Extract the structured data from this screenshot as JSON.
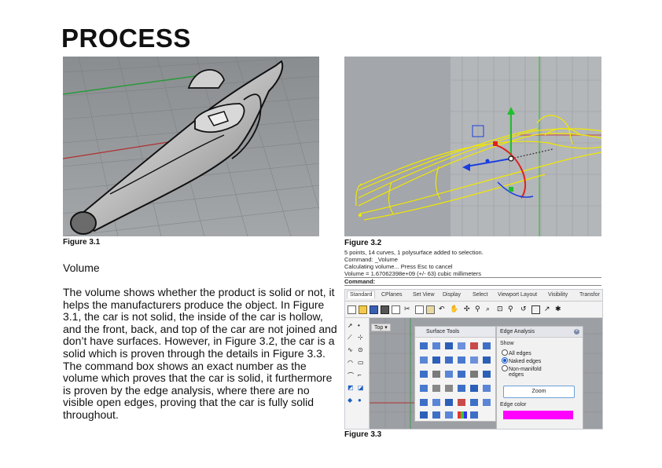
{
  "page": {
    "title": "PROCESS",
    "section_heading": "Volume",
    "body": "The volume shows whether the product is solid or not, it helps the manufacturers produce the object. In Figure 3.1, the car is not solid, the inside of the car is hollow, and the front, back, and top of the car are not joined and don’t have surfaces. However, in Figure 3.2, the car is a solid which is proven through the details in Figure 3.3. The command box shows an exact number as the volume which proves that the car is solid, it furthermore is proven by the edge analysis, where there are no visible open edges, proving that the car is fully solid throughout."
  },
  "figures": {
    "fig1_caption": "Figure 3.1",
    "fig2_caption": "Figure 3.2",
    "fig3_caption": "Figure 3.3"
  },
  "command_box": {
    "lines": [
      "5 points, 14 curves, 1 polysurface added to selection.",
      "Command: _Volume",
      "Calculating volume... Press Esc to cancel",
      "Volume = 1.67062398e+09 (+/- 63) cubic millimeters"
    ],
    "prompt": "Command:"
  },
  "rhino_ui": {
    "tabs": [
      "Standard",
      "CPlanes",
      "Set View",
      "Display",
      "Select",
      "Viewport Layout",
      "Visibility",
      "Transfor"
    ],
    "viewport_label": "Top",
    "surface_tools_title": "Surface Tools",
    "edge_analysis": {
      "title": "Edge Analysis",
      "show_label": "Show",
      "options": [
        "All edges",
        "Naked edges",
        "Non-manifold",
        "edges"
      ],
      "selected": "Naked edges",
      "zoom_button": "Zoom",
      "edge_color_label": "Edge color",
      "edge_color": "#ff00ff"
    }
  },
  "colors": {
    "viewport_grey": "#9c9fa3",
    "wire_yellow": "#f0e800",
    "axis_red": "#e02020",
    "axis_green": "#20c020",
    "axis_blue": "#1a3fe0"
  }
}
